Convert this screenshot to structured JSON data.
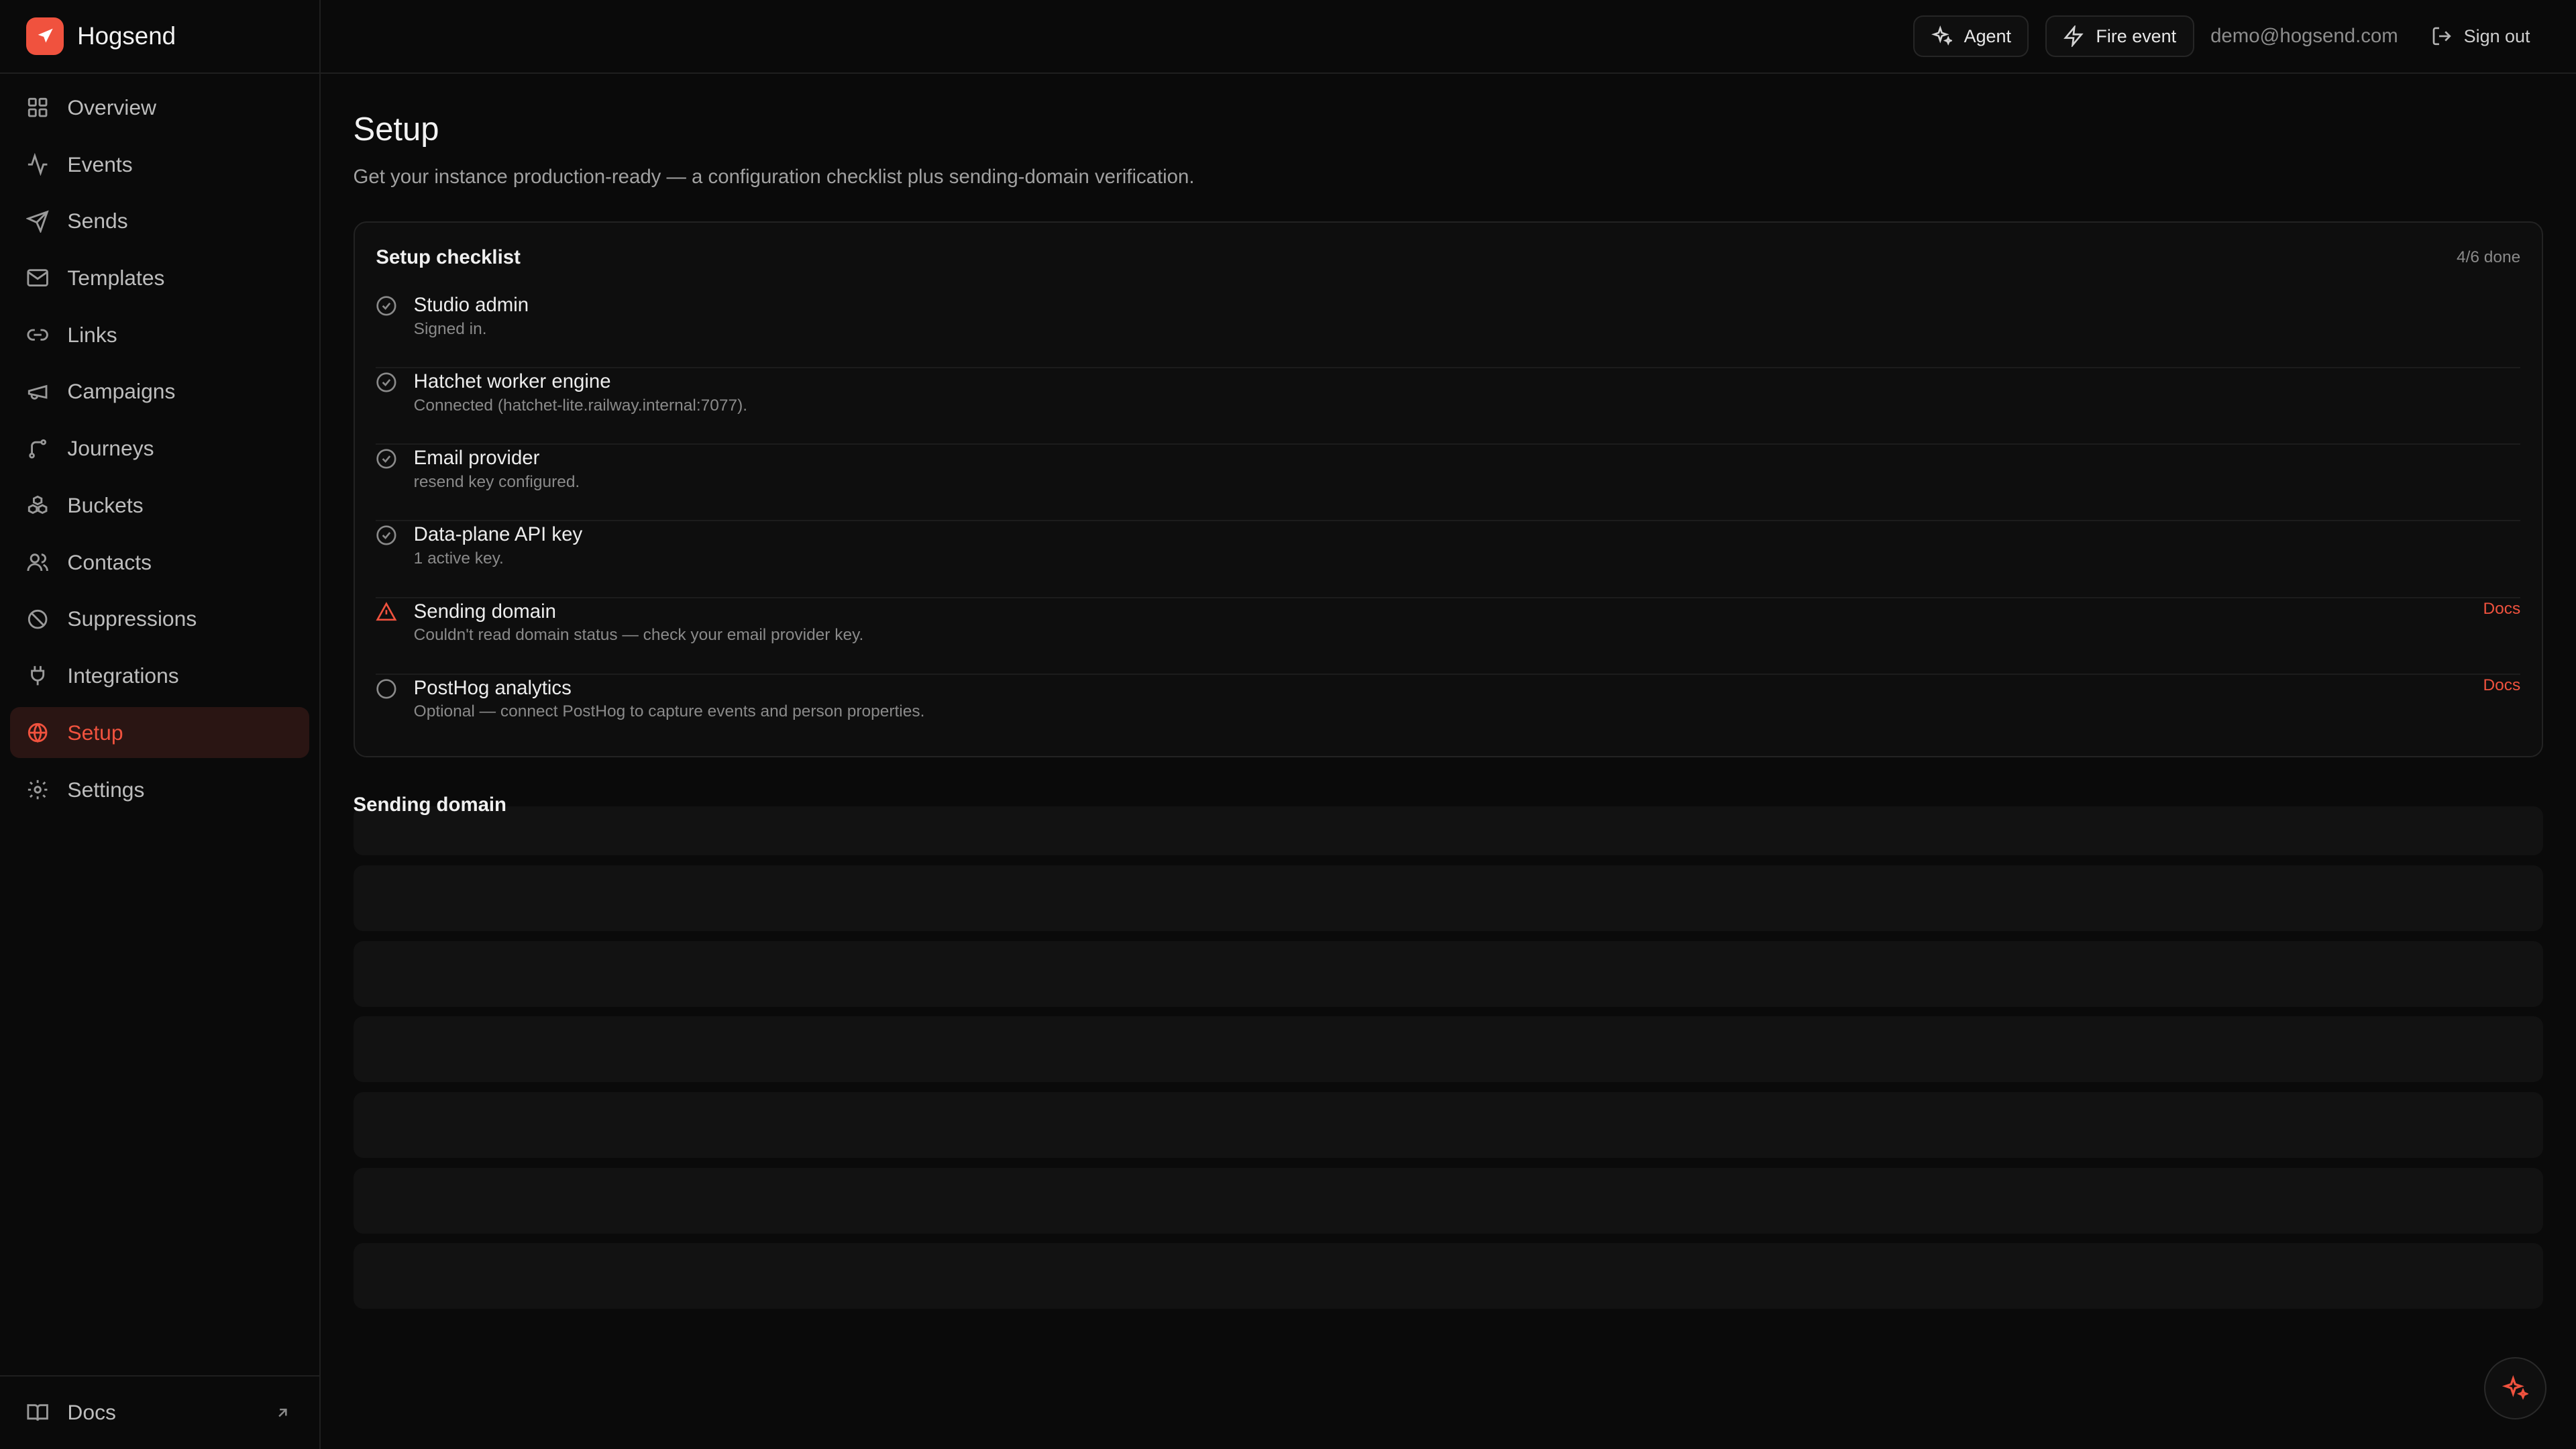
{
  "app": {
    "name": "Hogsend",
    "accent": "#f0523e"
  },
  "sidebar": {
    "items": [
      {
        "label": "Overview",
        "icon": "grid-icon"
      },
      {
        "label": "Events",
        "icon": "activity-icon"
      },
      {
        "label": "Sends",
        "icon": "send-icon"
      },
      {
        "label": "Templates",
        "icon": "mail-icon"
      },
      {
        "label": "Links",
        "icon": "link-icon"
      },
      {
        "label": "Campaigns",
        "icon": "megaphone-icon"
      },
      {
        "label": "Journeys",
        "icon": "git-branch-icon"
      },
      {
        "label": "Buckets",
        "icon": "boxes-icon"
      },
      {
        "label": "Contacts",
        "icon": "users-icon"
      },
      {
        "label": "Suppressions",
        "icon": "ban-icon"
      },
      {
        "label": "Integrations",
        "icon": "plug-icon"
      },
      {
        "label": "Setup",
        "icon": "globe-icon",
        "active": true
      },
      {
        "label": "Settings",
        "icon": "gear-icon"
      }
    ],
    "footer": {
      "label": "Docs",
      "icon": "book-icon"
    }
  },
  "topbar": {
    "agent_label": "Agent",
    "fire_event_label": "Fire event",
    "email": "demo@hogsend.com",
    "signout_label": "Sign out"
  },
  "page": {
    "title": "Setup",
    "subtitle": "Get your instance production-ready — a configuration checklist plus sending-domain verification."
  },
  "checklist": {
    "title": "Setup checklist",
    "progress": "4/6 done",
    "items": [
      {
        "title": "Studio admin",
        "desc": "Signed in.",
        "status": "done",
        "link": ""
      },
      {
        "title": "Hatchet worker engine",
        "desc": "Connected (hatchet-lite.railway.internal:7077).",
        "status": "done",
        "link": ""
      },
      {
        "title": "Email provider",
        "desc": "resend key configured.",
        "status": "done",
        "link": ""
      },
      {
        "title": "Data-plane API key",
        "desc": "1 active key.",
        "status": "done",
        "link": ""
      },
      {
        "title": "Sending domain",
        "desc": "Couldn't read domain status — check your email provider key.",
        "status": "warning",
        "link": "Docs"
      },
      {
        "title": "PostHog analytics",
        "desc": "Optional — connect PostHog to capture events and person properties.",
        "status": "pending",
        "link": "Docs"
      }
    ]
  },
  "sending_domain": {
    "title": "Sending domain"
  }
}
